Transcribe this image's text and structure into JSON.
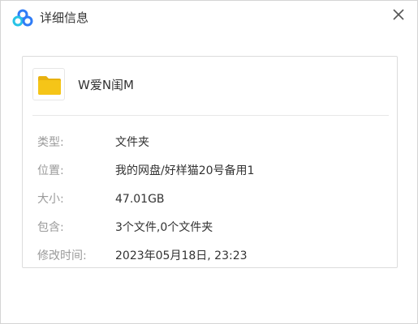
{
  "window": {
    "title": "详细信息",
    "app_icon": "baidu-netdisk-cloud-icon",
    "close_icon": "close-icon"
  },
  "file": {
    "icon": "folder-icon",
    "folder_color": "#F5C518",
    "name": "W爱N闺M"
  },
  "details": [
    {
      "label": "类型:",
      "value": "文件夹"
    },
    {
      "label": "位置:",
      "value": "我的网盘/好样猫20号备用1"
    },
    {
      "label": "大小:",
      "value": "47.01GB"
    },
    {
      "label": "包含:",
      "value": "3个文件,0个文件夹"
    },
    {
      "label": "修改时间:",
      "value": "2023年05月18日, 23:23"
    }
  ],
  "colors": {
    "label": "#9A9A9A",
    "value": "#333333",
    "border": "#DCDCDC",
    "brand_blue": "#2F7CF6",
    "brand_cyan": "#27C3E6"
  }
}
